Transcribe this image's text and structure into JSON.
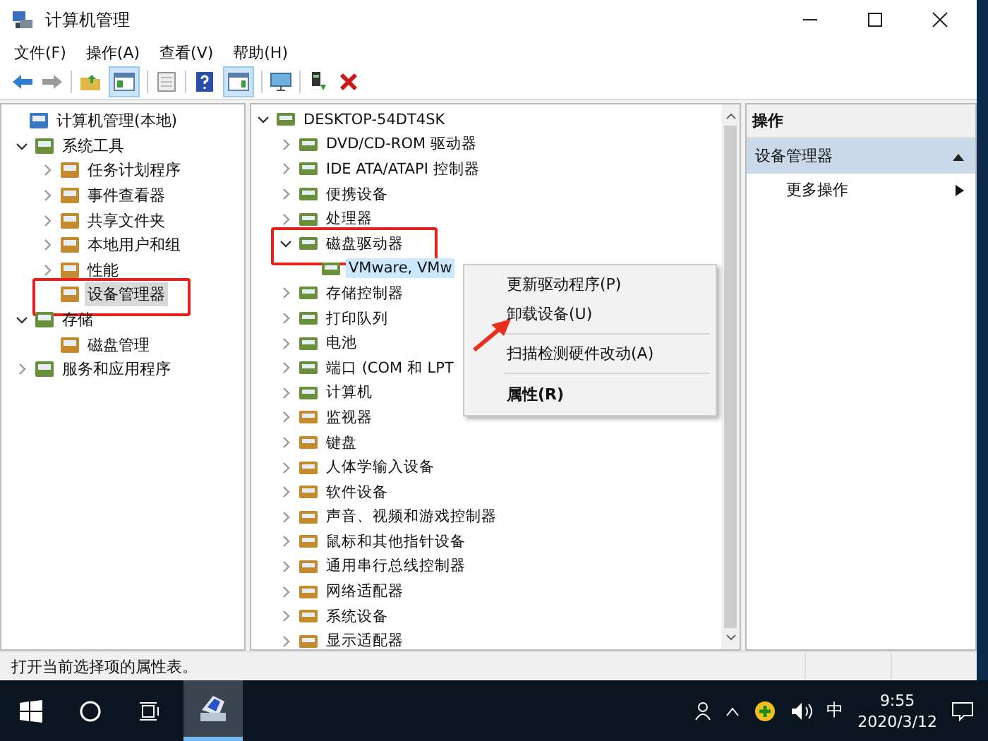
{
  "window": {
    "title": "计算机管理"
  },
  "menu": [
    "文件(F)",
    "操作(A)",
    "查看(V)",
    "帮助(H)"
  ],
  "left_tree": [
    {
      "label": "计算机管理(本地)",
      "selected": false,
      "annotated": false,
      "children": [
        {
          "label": "系统工具",
          "expanded": true,
          "selected": false,
          "annotated": false,
          "children": [
            {
              "label": "任务计划程序",
              "expanded": false,
              "selected": false,
              "annotated": false
            },
            {
              "label": "事件查看器",
              "expanded": false,
              "selected": false,
              "annotated": false
            },
            {
              "label": "共享文件夹",
              "expanded": false,
              "selected": false,
              "annotated": false
            },
            {
              "label": "本地用户和组",
              "expanded": false,
              "selected": false,
              "annotated": false
            },
            {
              "label": "性能",
              "expanded": false,
              "selected": false,
              "annotated": false
            },
            {
              "label": "设备管理器",
              "selected": true,
              "annotated": true
            }
          ]
        },
        {
          "label": "存储",
          "expanded": true,
          "selected": false,
          "annotated": false,
          "children": [
            {
              "label": "磁盘管理",
              "selected": false,
              "annotated": false
            }
          ]
        },
        {
          "label": "服务和应用程序",
          "expanded": false,
          "selected": false,
          "annotated": false
        }
      ]
    }
  ],
  "device_tree": [
    {
      "label": "DESKTOP-54DT4SK",
      "expanded": true,
      "selected": false,
      "annotated": false,
      "children": [
        {
          "label": "DVD/CD-ROM 驱动器",
          "expanded": false,
          "selected": false,
          "annotated": false
        },
        {
          "label": "IDE ATA/ATAPI 控制器",
          "expanded": false,
          "selected": false,
          "annotated": false
        },
        {
          "label": "便携设备",
          "expanded": false,
          "selected": false,
          "annotated": false
        },
        {
          "label": "处理器",
          "expanded": false,
          "selected": false,
          "annotated": false
        },
        {
          "label": "磁盘驱动器",
          "expanded": true,
          "selected": false,
          "annotated": true,
          "children": [
            {
              "label": "VMware, VMw",
              "selected": true,
              "annotated": false
            }
          ]
        },
        {
          "label": "存储控制器",
          "expanded": false,
          "selected": false,
          "annotated": false
        },
        {
          "label": "打印队列",
          "expanded": false,
          "selected": false,
          "annotated": false
        },
        {
          "label": "电池",
          "expanded": false,
          "selected": false,
          "annotated": false
        },
        {
          "label": "端口 (COM 和 LPT",
          "expanded": false,
          "selected": false,
          "annotated": false
        },
        {
          "label": "计算机",
          "expanded": false,
          "selected": false,
          "annotated": false
        },
        {
          "label": "监视器",
          "expanded": false,
          "selected": false,
          "annotated": false
        },
        {
          "label": "键盘",
          "expanded": false,
          "selected": false,
          "annotated": false
        },
        {
          "label": "人体学输入设备",
          "expanded": false,
          "selected": false,
          "annotated": false
        },
        {
          "label": "软件设备",
          "expanded": false,
          "selected": false,
          "annotated": false
        },
        {
          "label": "声音、视频和游戏控制器",
          "expanded": false,
          "selected": false,
          "annotated": false
        },
        {
          "label": "鼠标和其他指针设备",
          "expanded": false,
          "selected": false,
          "annotated": false
        },
        {
          "label": "通用串行总线控制器",
          "expanded": false,
          "selected": false,
          "annotated": false
        },
        {
          "label": "网络适配器",
          "expanded": false,
          "selected": false,
          "annotated": false
        },
        {
          "label": "系统设备",
          "expanded": false,
          "selected": false,
          "annotated": false
        },
        {
          "label": "显示适配器",
          "expanded": false,
          "selected": false,
          "annotated": false
        }
      ]
    }
  ],
  "context_menu": {
    "annotation_arrow": true,
    "items": [
      {
        "kind": "item",
        "label": "更新驱动程序(P)",
        "bold": false
      },
      {
        "kind": "item",
        "label": "卸载设备(U)",
        "bold": false
      },
      {
        "kind": "separator"
      },
      {
        "kind": "item",
        "label": "扫描检测硬件改动(A)",
        "bold": false
      },
      {
        "kind": "separator"
      },
      {
        "kind": "item",
        "label": "属性(R)",
        "bold": true
      }
    ]
  },
  "actions_pane": {
    "header": "操作",
    "section": {
      "label": "设备管理器",
      "expanded": true
    },
    "items": [
      "更多操作"
    ]
  },
  "status_bar": "打开当前选择项的属性表。",
  "taskbar": {
    "input_method": "中",
    "time": "9:55",
    "date": "2020/3/12"
  }
}
